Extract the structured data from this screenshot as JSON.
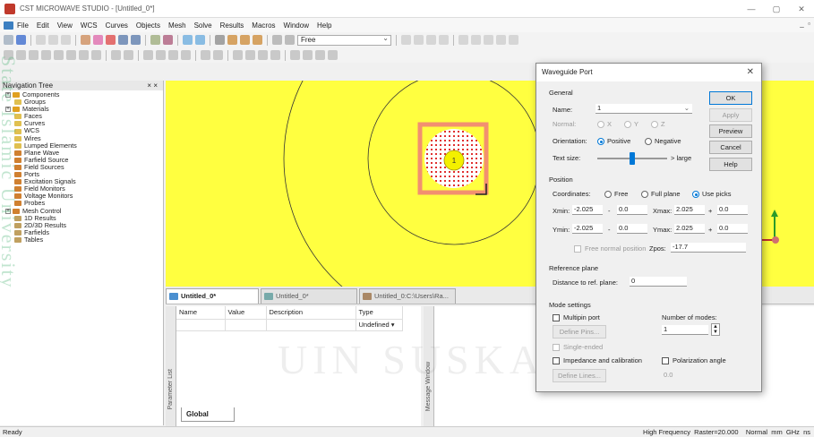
{
  "window": {
    "title": "CST MICROWAVE STUDIO - [Untitled_0*]"
  },
  "menu": [
    "File",
    "Edit",
    "View",
    "WCS",
    "Curves",
    "Objects",
    "Mesh",
    "Solve",
    "Results",
    "Macros",
    "Window",
    "Help"
  ],
  "toolbar": {
    "mode_value": "Free"
  },
  "nav_tree": {
    "title": "Navigation Tree",
    "close": "× ×",
    "items": [
      {
        "label": "Components",
        "color": "#e0a020",
        "exp": "+"
      },
      {
        "label": "Groups",
        "color": "#e0c050",
        "exp": ""
      },
      {
        "label": "Materials",
        "color": "#e0a020",
        "exp": "+"
      },
      {
        "label": "Faces",
        "color": "#e0c050",
        "exp": ""
      },
      {
        "label": "Curves",
        "color": "#e0c050",
        "exp": ""
      },
      {
        "label": "WCS",
        "color": "#e0c050",
        "exp": ""
      },
      {
        "label": "Wires",
        "color": "#e0c050",
        "exp": ""
      },
      {
        "label": "Lumped Elements",
        "color": "#e0c050",
        "exp": ""
      },
      {
        "label": "Plane Wave",
        "color": "#d08030",
        "exp": ""
      },
      {
        "label": "Farfield Source",
        "color": "#d08030",
        "exp": ""
      },
      {
        "label": "Field Sources",
        "color": "#d08030",
        "exp": ""
      },
      {
        "label": "Ports",
        "color": "#d08030",
        "exp": ""
      },
      {
        "label": "Excitation Signals",
        "color": "#d08030",
        "exp": ""
      },
      {
        "label": "Field Monitors",
        "color": "#d08030",
        "exp": ""
      },
      {
        "label": "Voltage Monitors",
        "color": "#d08030",
        "exp": ""
      },
      {
        "label": "Probes",
        "color": "#d08030",
        "exp": ""
      },
      {
        "label": "Mesh Control",
        "color": "#d08030",
        "exp": "+"
      },
      {
        "label": "1D Results",
        "color": "#c0a060",
        "exp": ""
      },
      {
        "label": "2D/3D Results",
        "color": "#c0a060",
        "exp": ""
      },
      {
        "label": "Farfields",
        "color": "#c0a060",
        "exp": ""
      },
      {
        "label": "Tables",
        "color": "#c0a060",
        "exp": ""
      }
    ]
  },
  "viewport": {
    "background": "#ffff40",
    "port_number": "1"
  },
  "doc_tabs": [
    {
      "label": "Untitled_0*",
      "state": "active"
    },
    {
      "label": "Untitled_0*",
      "state": "inactive"
    },
    {
      "label": "Untitled_0:C:\\Users\\Ra...",
      "state": "inactive"
    }
  ],
  "param_list": {
    "side_label": "Parameter List",
    "columns": [
      "Name",
      "Value",
      "Description",
      "Type"
    ],
    "first_row_type": "Undefined",
    "global_tab": "Global"
  },
  "message_window": {
    "side_label": "Message Window"
  },
  "status": {
    "left": "Ready",
    "right": "High Frequency  Raster=20.000    Normal  mm  GHz  ns"
  },
  "watermark": {
    "side_text": "State Islamic University",
    "center_text": "UIN SUSKA RI"
  },
  "dialog": {
    "title": "Waveguide Port",
    "general": {
      "label": "General",
      "name_label": "Name:",
      "name_value": "1",
      "normal_label": "Normal:",
      "normal_options": [
        "X",
        "Y",
        "Z"
      ],
      "orientation_label": "Orientation:",
      "positive": "Positive",
      "negative": "Negative",
      "textsize_label": "Text size:",
      "large": "> large",
      "textsize_level": 0.5
    },
    "buttons": {
      "ok": "OK",
      "apply": "Apply",
      "preview": "Preview",
      "cancel": "Cancel",
      "help": "Help"
    },
    "position": {
      "label": "Position",
      "coords_label": "Coordinates:",
      "free": "Free",
      "full_plane": "Full plane",
      "use_picks": "Use picks",
      "xmin_label": "Xmin:",
      "xmin": "-2.025",
      "xmin_off": "0.0",
      "xmax_label": "Xmax:",
      "xmax": "2.025",
      "xmax_off": "0.0",
      "ymin_label": "Ymin:",
      "ymin": "-2.025",
      "ymin_off": "0.0",
      "ymax_label": "Ymax:",
      "ymax": "2.025",
      "ymax_off": "0.0",
      "free_normal": "Free normal position",
      "zpos_label": "Zpos:",
      "zpos": "-17.7",
      "minus": "-",
      "plus": "+"
    },
    "reference": {
      "label": "Reference plane",
      "dist_label": "Distance to ref. plane:",
      "dist_value": "0"
    },
    "mode": {
      "label": "Mode settings",
      "multipin": "Multipin port",
      "define_pins": "Define Pins...",
      "num_modes_label": "Number of modes:",
      "num_modes": "1",
      "single_ended": "Single-ended",
      "impedance": "Impedance and calibration",
      "polarization": "Polarization angle",
      "pol_value": "0.0",
      "define_lines": "Define Lines..."
    }
  }
}
